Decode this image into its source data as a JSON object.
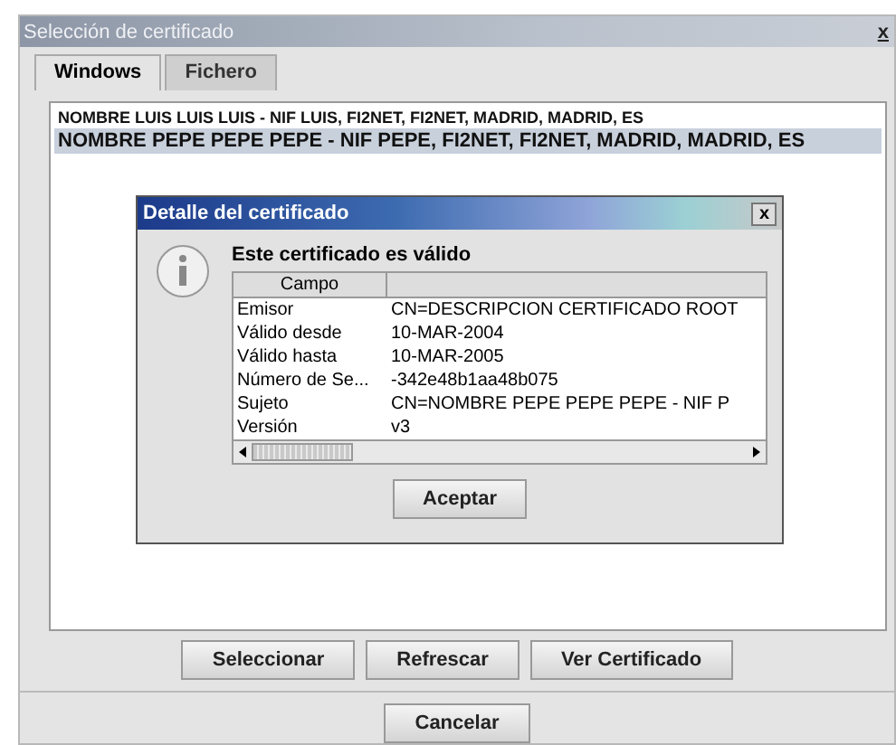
{
  "window": {
    "title": "Selección de certificado",
    "close": "x"
  },
  "tabs": [
    {
      "label": "Windows",
      "selected": true
    },
    {
      "label": "Fichero",
      "selected": false
    }
  ],
  "certificates": [
    {
      "label": "NOMBRE LUIS LUIS LUIS - NIF LUIS, FI2NET, FI2NET, MADRID, MADRID, ES",
      "selected": false
    },
    {
      "label": "NOMBRE PEPE PEPE PEPE - NIF PEPE, FI2NET, FI2NET, MADRID, MADRID, ES",
      "selected": true
    }
  ],
  "dialog": {
    "title": "Detalle del certificado",
    "close": "x",
    "message": "Este certificado es válido",
    "columns": [
      "Campo"
    ],
    "rows": [
      {
        "field": "Emisor",
        "value": "CN=DESCRIPCION CERTIFICADO ROOT"
      },
      {
        "field": "Válido desde",
        "value": "10-MAR-2004"
      },
      {
        "field": "Válido hasta",
        "value": "10-MAR-2005"
      },
      {
        "field": "Número de Se...",
        "value": "-342e48b1aa48b075"
      },
      {
        "field": "Sujeto",
        "value": "CN=NOMBRE PEPE PEPE PEPE - NIF P"
      },
      {
        "field": "Versión",
        "value": "v3"
      }
    ],
    "button": "Aceptar"
  },
  "buttons": [
    "Seleccionar",
    "Refrescar",
    "Ver Certificado"
  ],
  "cancel": "Cancelar"
}
